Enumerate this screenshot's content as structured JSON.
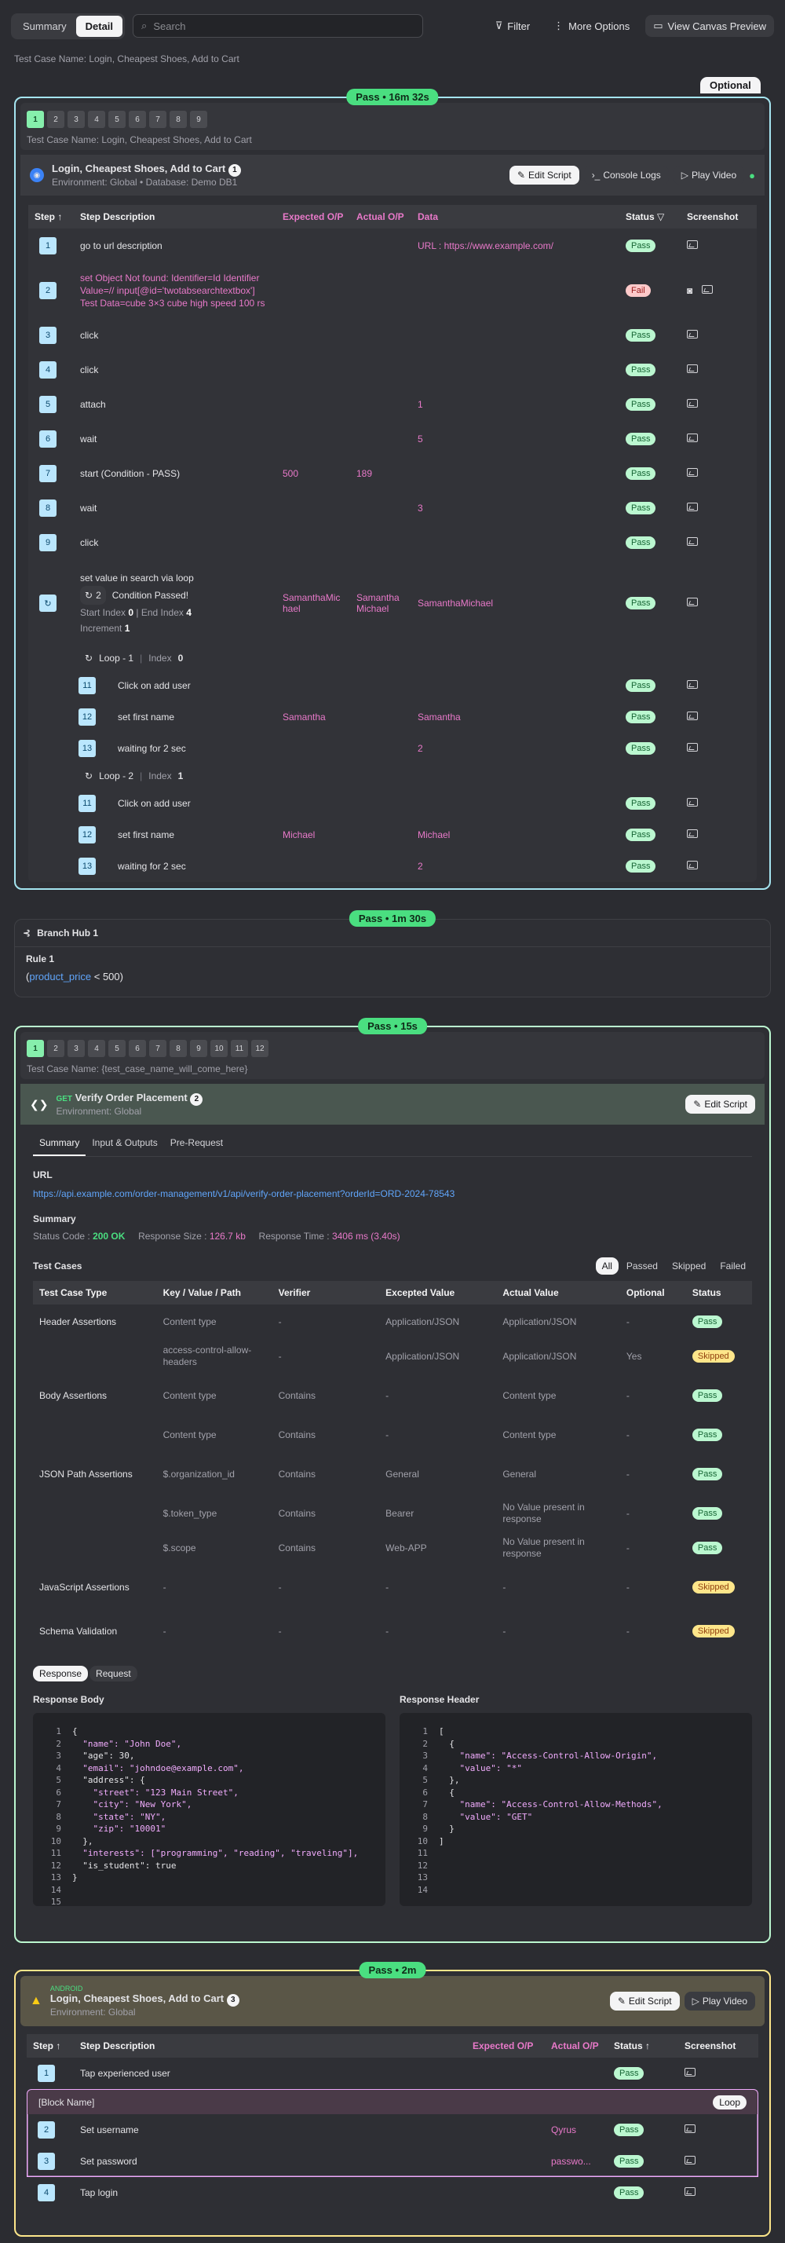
{
  "topbar": {
    "tabs": [
      "Summary",
      "Detail"
    ],
    "active_tab": "Detail",
    "search_placeholder": "Search",
    "filter": "Filter",
    "more": "More Options",
    "canvas": "View Canvas Preview"
  },
  "breadcrumb": "Test Case Name: Login, Cheapest Shoes, Add to Cart",
  "p1": {
    "optional": "Optional",
    "status": "Pass • 16m 32s",
    "pages": [
      "1",
      "2",
      "3",
      "4",
      "5",
      "6",
      "7",
      "8",
      "9"
    ],
    "tc_name": "Test Case Name: Login, Cheapest Shoes, Add to Cart",
    "title": "Login, Cheapest Shoes, Add to Cart",
    "env": "Environment: Global • Database: Demo DB1",
    "badge": "1",
    "edit": "Edit Script",
    "logs": "Console Logs",
    "video": "Play Video",
    "cols": [
      "Step",
      "Step Description",
      "Expected O/P",
      "Actual O/P",
      "Data",
      "Status",
      "Screenshot"
    ],
    "rows": [
      {
        "n": "1",
        "d": "go to url description",
        "e": "",
        "a": "",
        "data": "URL : https://www.example.com/",
        "s": "Pass"
      },
      {
        "n": "2",
        "d": "set Object Not found: Identifier=Id Identifier Value=// input[@id='twotabsearchtextbox'] Test Data=cube 3×3 cube high speed 100 rs",
        "e": "",
        "a": "",
        "data": "",
        "s": "Fail"
      },
      {
        "n": "3",
        "d": "click",
        "e": "",
        "a": "",
        "data": "",
        "s": "Pass"
      },
      {
        "n": "4",
        "d": "click",
        "e": "",
        "a": "",
        "data": "",
        "s": "Pass"
      },
      {
        "n": "5",
        "d": "attach",
        "e": "",
        "a": "",
        "data": "1",
        "s": "Pass"
      },
      {
        "n": "6",
        "d": "wait",
        "e": "",
        "a": "",
        "data": "5",
        "s": "Pass"
      },
      {
        "n": "7",
        "d": "start (Condition - PASS)",
        "e": "500",
        "a": "189",
        "data": "",
        "s": "Pass"
      },
      {
        "n": "8",
        "d": "wait",
        "e": "",
        "a": "",
        "data": "3",
        "s": "Pass"
      },
      {
        "n": "9",
        "d": "click",
        "e": "",
        "a": "",
        "data": "",
        "s": "Pass"
      }
    ],
    "loop": {
      "d": "set value in search via loop",
      "cond_count": "2",
      "cond": "Condition Passed!",
      "start": "Start Index",
      "start_v": "0",
      "end": "End Index",
      "end_v": "4",
      "inc": "Increment",
      "inc_v": "1",
      "e": "SamanthaMichael",
      "a": "SamanthaMichael",
      "data": "SamanthaMichael",
      "s": "Pass",
      "loops": [
        {
          "label": "Loop - 1",
          "idx": "Index",
          "idx_v": "0",
          "rows": [
            {
              "n": "11",
              "d": "Click on add user",
              "e": "",
              "data": "",
              "s": "Pass"
            },
            {
              "n": "12",
              "d": "set first name",
              "e": "Samantha",
              "data": "Samantha",
              "s": "Pass"
            },
            {
              "n": "13",
              "d": "waiting for 2 sec",
              "e": "",
              "data": "2",
              "s": "Pass"
            }
          ]
        },
        {
          "label": "Loop - 2",
          "idx": "Index",
          "idx_v": "1",
          "rows": [
            {
              "n": "11",
              "d": "Click on add user",
              "e": "",
              "data": "",
              "s": "Pass"
            },
            {
              "n": "12",
              "d": "set first name",
              "e": "Michael",
              "data": "Michael",
              "s": "Pass"
            },
            {
              "n": "13",
              "d": "waiting for 2 sec",
              "e": "",
              "data": "2",
              "s": "Pass"
            }
          ]
        }
      ]
    }
  },
  "branch": {
    "status": "Pass • 1m 30s",
    "title": "Branch Hub 1",
    "rule": "Rule 1",
    "var": "product_price",
    "cond": " < 500)"
  },
  "p2": {
    "status": "Pass • 15s",
    "pages": [
      "1",
      "2",
      "3",
      "4",
      "5",
      "6",
      "7",
      "8",
      "9",
      "10",
      "11",
      "12"
    ],
    "tc_name": "Test Case Name: {test_case_name_will_come_here}",
    "method": "GET",
    "title": "Verify Order Placement",
    "env": "Environment: Global",
    "badge": "2",
    "edit": "Edit Script",
    "tabs": [
      "Summary",
      "Input & Outputs",
      "Pre-Request"
    ],
    "url_label": "URL",
    "url": "https://api.example.com/order-management/v1/api/verify-order-placement?orderId=ORD-2024-78543",
    "summary": "Summary",
    "sc_label": "Status Code :",
    "sc": "200 OK",
    "rs_label": "Response Size :",
    "rs": "126.7 kb",
    "rt_label": "Response Time :",
    "rt": "3406 ms (3.40s)",
    "tc_label": "Test Cases",
    "filters": [
      "All",
      "Passed",
      "Skipped",
      "Failed"
    ],
    "cols": [
      "Test Case Type",
      "Key / Value / Path",
      "Verifier",
      "Excepted Value",
      "Actual Value",
      "Optional",
      "Status"
    ],
    "rows": [
      [
        "Header Assertions",
        "Content type",
        "-",
        "Application/JSON",
        "Application/JSON",
        "-",
        "Pass"
      ],
      [
        "",
        "access-control-allow-headers",
        "-",
        "Application/JSON",
        "Application/JSON",
        "Yes",
        "Skipped"
      ],
      [
        "Body Assertions",
        "Content type",
        "Contains",
        "-",
        "Content type",
        "-",
        "Pass"
      ],
      [
        "",
        "Content type",
        "Contains",
        "-",
        "Content type",
        "-",
        "Pass"
      ],
      [
        "JSON Path Assertions",
        "$.organization_id",
        "Contains",
        "General",
        "General",
        "-",
        "Pass"
      ],
      [
        "",
        "$.token_type",
        "Contains",
        "Bearer",
        "No Value present in response",
        "-",
        "Pass"
      ],
      [
        "",
        "$.scope",
        "Contains",
        "Web-APP",
        "No Value present in response",
        "-",
        "Pass"
      ],
      [
        "JavaScript Assertions",
        "-",
        "-",
        "-",
        "-",
        "-",
        "Skipped"
      ],
      [
        "Schema Validation",
        "-",
        "-",
        "-",
        "-",
        "-",
        "Skipped"
      ]
    ],
    "resp_tabs": [
      "Response",
      "Request"
    ],
    "body_label": "Response Body",
    "head_label": "Response Header",
    "body": [
      "{",
      "  \"name\": \"John Doe\",",
      "  \"age\": 30,",
      "  \"email\": \"johndoe@example.com\",",
      "  \"address\": {",
      "    \"street\": \"123 Main Street\",",
      "    \"city\": \"New York\",",
      "    \"state\": \"NY\",",
      "    \"zip\": \"10001\"",
      "  },",
      "  \"interests\": [\"programming\", \"reading\", \"traveling\"],",
      "  \"is_student\": true",
      "}",
      "",
      ""
    ],
    "head": [
      "[",
      "  {",
      "    \"name\": \"Access-Control-Allow-Origin\",",
      "    \"value\": \"*\"",
      "  },",
      "  {",
      "    \"name\": \"Access-Control-Allow-Methods\",",
      "    \"value\": \"GET\"",
      "  }",
      "]",
      "",
      "",
      "",
      ""
    ]
  },
  "p3": {
    "status": "Pass • 2m",
    "platform": "ANDROID",
    "title": "Login, Cheapest Shoes, Add to Cart",
    "badge": "3",
    "env": "Environment: Global",
    "edit": "Edit Script",
    "video": "Play Video",
    "cols": [
      "Step",
      "Step Description",
      "Expected O/P",
      "Actual O/P",
      "Status",
      "Screenshot"
    ],
    "row1": {
      "n": "1",
      "d": "Tap experienced user",
      "s": "Pass"
    },
    "block": "[Block Name]",
    "loop": "Loop",
    "brows": [
      {
        "n": "2",
        "d": "Set username",
        "a": "Qyrus",
        "s": "Pass"
      },
      {
        "n": "3",
        "d": "Set password",
        "a": "passwo...",
        "s": "Pass"
      }
    ],
    "row4": {
      "n": "4",
      "d": "Tap login",
      "s": "Pass"
    }
  }
}
